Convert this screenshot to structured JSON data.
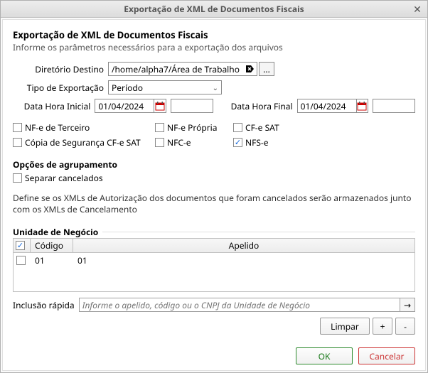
{
  "titlebar": {
    "title": "Exportação de XML de Documentos Fiscais"
  },
  "header": {
    "title": "Exportação de XML de Documentos Fiscais",
    "subtitle": "Informe os parâmetros necessários para a exportação dos arquivos"
  },
  "form": {
    "dir_label": "Diretório Destino",
    "dir_value": "/home/alpha7/Área de Trabalho",
    "browse_label": "...",
    "type_label": "Tipo de Exportação",
    "type_value": "Período",
    "start_label": "Data Hora Inicial",
    "start_date": "01/04/2024",
    "start_time": "",
    "end_label": "Data Hora Final",
    "end_date": "01/04/2024",
    "end_time": ""
  },
  "checks": {
    "nfe_terceiro": "NF-e de Terceiro",
    "nfe_propria": "NF-e Própria",
    "cfe_sat": "CF-e SAT",
    "copia_cfe": "Cópia de Segurança CF-e SAT",
    "nfce": "NFC-e",
    "nfse": "NFS-e"
  },
  "group": {
    "title": "Opções de agrupamento",
    "separar": "Separar cancelados",
    "desc": "Define se os XMLs de Autorização dos documentos que foram cancelados serão armazenados junto com os XMLs de Cancelamento"
  },
  "unit": {
    "title": "Unidade de Negócio",
    "th_code": "Código",
    "th_apelido": "Apelido",
    "rows": [
      {
        "code": "01",
        "apelido": "01"
      }
    ],
    "quick_label": "Inclusão rápida",
    "quick_placeholder": "Informe o apelido, código ou o CNPJ da Unidade de Negócio",
    "limpar": "Limpar",
    "plus": "+",
    "minus": "-"
  },
  "footer": {
    "ok": "OK",
    "cancel": "Cancelar"
  }
}
